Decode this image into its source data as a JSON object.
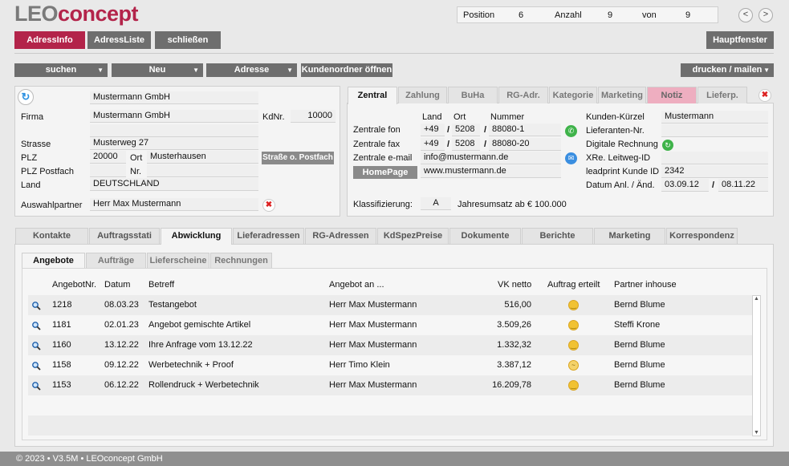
{
  "logo": {
    "part1": "LEO",
    "part2": "concept"
  },
  "nav": {
    "position_label": "Position",
    "position_value": "6",
    "anzahl_label": "Anzahl",
    "anzahl_value": "9",
    "von_label": "von",
    "von_value": "9",
    "prev": "<",
    "next": ">"
  },
  "topbuttons": {
    "adressinfo": "AdressInfo",
    "adressliste": "AdressListe",
    "schliessen": "schließen",
    "hauptfenster": "Hauptfenster"
  },
  "toolbar": {
    "suchen": "suchen",
    "neu": "Neu",
    "adresse": "Adresse",
    "kundenordner": "Kundenordner öffnen",
    "drucken": "drucken / mailen"
  },
  "left": {
    "name_top": "Mustermann GmbH",
    "firma_label": "Firma",
    "firma": "Mustermann GmbH",
    "kdnr_label": "KdNr.",
    "kdnr": "10000",
    "strasse_label": "Strasse",
    "strasse": "Musterweg 27",
    "plz_label": "PLZ",
    "plz": "20000",
    "ort_label": "Ort",
    "ort": "Musterhausen",
    "strasse_btn": "Straße o. Postfach",
    "plzpf_label": "PLZ Postfach",
    "nr_label": "Nr.",
    "land_label": "Land",
    "land": "DEUTSCHLAND",
    "partner_label": "Auswahlpartner",
    "partner": "Herr Max Mustermann"
  },
  "righttabs": [
    "Zentral",
    "Zahlung",
    "BuHa",
    "RG-Adr.",
    "Kategorie",
    "Marketing",
    "Notiz",
    "Lieferp."
  ],
  "right": {
    "h_land": "Land",
    "h_ort": "Ort",
    "h_nummer": "Nummer",
    "fon_label": "Zentrale fon",
    "fon_land": "+49",
    "fon_ort": "5208",
    "fon_nr": "88080-1",
    "fax_label": "Zentrale fax",
    "fax_land": "+49",
    "fax_ort": "5208",
    "fax_nr": "88080-20",
    "email_label": "Zentrale e-mail",
    "email": "info@mustermann.de",
    "homepage_btn": "HomePage",
    "homepage": "www.mustermann.de",
    "slash": "/",
    "kuerzel_label": "Kunden-Kürzel",
    "kuerzel": "Mustermann",
    "lief_label": "Lieferanten-Nr.",
    "digi_label": "Digitale Rechnung",
    "xre_label": "XRe. Leitweg-ID",
    "leadprint_label": "leadprint Kunde ID",
    "leadprint": "2342",
    "datum_label": "Datum Anl. / Änd.",
    "datum_anl": "03.09.12",
    "datum_aend": "08.11.22",
    "klass_label": "Klassifizierung:",
    "klass": "A",
    "umsatz": "Jahresumsatz ab € 100.000"
  },
  "maintabs": [
    "Kontakte",
    "Auftragsstati",
    "Abwicklung",
    "Lieferadressen",
    "RG-Adressen",
    "KdSpezPreise",
    "Dokumente",
    "Berichte",
    "Marketing",
    "Korrespondenz"
  ],
  "subtabs": [
    "Angebote",
    "Aufträge",
    "Lieferscheine",
    "Rechnungen"
  ],
  "table": {
    "headers": [
      "AngebotNr.",
      "Datum",
      "Betreff",
      "Angebot an ...",
      "VK netto",
      "Auftrag erteilt",
      "Partner inhouse"
    ],
    "rows": [
      {
        "nr": "1218",
        "datum": "08.03.23",
        "betreff": "Testangebot",
        "an": "Herr Max Mustermann",
        "vk": "516,00",
        "partner": "Bernd Blume"
      },
      {
        "nr": "1181",
        "datum": "02.01.23",
        "betreff": "Angebot gemischte Artikel",
        "an": "Herr Max Mustermann",
        "vk": "3.509,26",
        "partner": "Steffi Krone"
      },
      {
        "nr": "1160",
        "datum": "13.12.22",
        "betreff": "Ihre Anfrage vom 13.12.22",
        "an": "Herr Max Mustermann",
        "vk": "1.332,32",
        "partner": "Bernd Blume"
      },
      {
        "nr": "1158",
        "datum": "09.12.22",
        "betreff": "Werbetechnik + Proof",
        "an": "Herr Timo Klein",
        "vk": "3.387,12",
        "partner": "Bernd Blume"
      },
      {
        "nr": "1153",
        "datum": "06.12.22",
        "betreff": "Rollendruck + Werbetechnik",
        "an": "Herr Max Mustermann",
        "vk": "16.209,78",
        "partner": "Bernd Blume"
      }
    ]
  },
  "footer": "© 2023 • V3.5M • LEOconcept GmbH"
}
